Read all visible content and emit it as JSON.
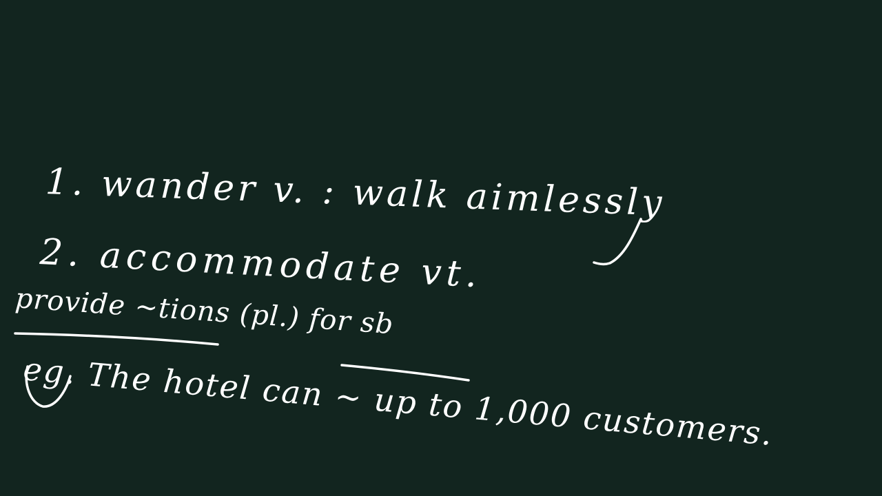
{
  "board": {
    "background": "#12251f",
    "ink_color": "#ffffff",
    "lines": [
      "1. wander v. : walk aimlessly",
      "2. accommodate vt.",
      "provide ~tions (pl.) for sb",
      "eg. The hotel can ~ up to 1,000 customers."
    ]
  }
}
